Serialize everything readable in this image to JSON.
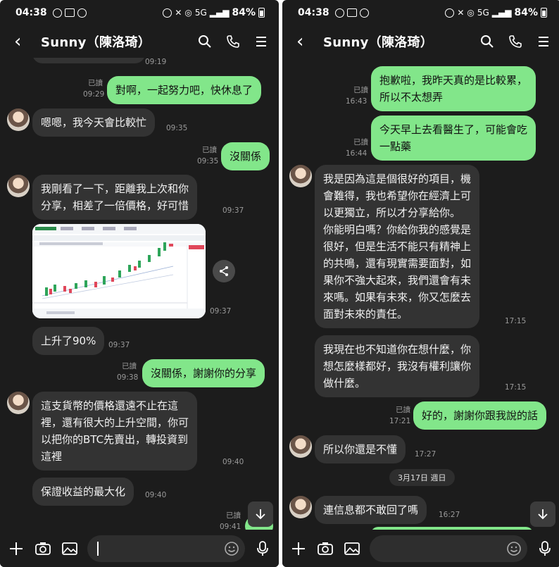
{
  "status": {
    "time": "04:38",
    "battery": "84%",
    "network": "5G"
  },
  "header": {
    "title": "Sunny（陳洛琦）"
  },
  "left": {
    "top_cutoff_time": "09:19",
    "messages": [
      {
        "dir": "out",
        "text": "對啊，一起努力吧，快休息了",
        "read": "已讀",
        "time": "09:29"
      },
      {
        "dir": "in",
        "text": "嗯嗯，我今天會比較忙",
        "time": "09:35"
      },
      {
        "dir": "out",
        "text": "沒關係",
        "read": "已讀",
        "time": "09:35"
      },
      {
        "dir": "in",
        "text": "我剛看了一下，距離我上次和你\n分享，相差了一倍價格，好可惜",
        "time": "09:37"
      },
      {
        "dir": "img",
        "time": "09:37"
      },
      {
        "dir": "in",
        "text": "上升了90%",
        "time": "09:37"
      },
      {
        "dir": "out",
        "text": "沒關係，謝謝你的分享",
        "read": "已讀",
        "time": "09:38"
      },
      {
        "dir": "in",
        "text": "這支貨幣的價格還遠不止在這\n裡，還有很大的上升空間，你可\n以把你的BTC先賣出，轉投資到\n這裡",
        "time": "09:40"
      },
      {
        "dir": "in",
        "text": "保證收益的最大化",
        "time": "09:40"
      },
      {
        "dir": "out",
        "text": "",
        "read": "已讀",
        "time": "09:41"
      }
    ]
  },
  "right": {
    "messages": [
      {
        "dir": "out",
        "text": "抱歉啦，我昨天真的是比較累，\n所以不太想弄",
        "read": "已讀",
        "time": "16:43"
      },
      {
        "dir": "out",
        "text": "今天早上去看醫生了，可能會吃\n一點藥",
        "read": "已讀",
        "time": "16:44"
      },
      {
        "dir": "in",
        "text": "我是因為這是個很好的項目，機\n會難得，我也希望你在經濟上可\n以更獨立，所以才分享給你。\n你能明白嗎？你給你我的感覺是\n很好，但是生活不能只有精神上\n的共鳴，還有現實需要面對，如\n果你不強大起來，我們還會有未\n來嗎。如果有未來，你又怎麼去\n面對未來的責任。",
        "time": "17:15"
      },
      {
        "dir": "in",
        "text": "我現在也不知道你在想什麼，你\n想怎麼樣都好，我沒有權利讓你\n做什麼。",
        "time": "17:15"
      },
      {
        "dir": "out",
        "text": "好的，謝謝你跟我說的話",
        "read": "已讀",
        "time": "17:21"
      },
      {
        "dir": "in",
        "text": "所以你還是不懂",
        "time": "17:27"
      },
      {
        "dir": "date",
        "text": "3月17日 週日"
      },
      {
        "dir": "in",
        "text": "連信息都不敢回了嗎",
        "time": "16:27"
      }
    ]
  },
  "icons": {
    "back": "chevron-left-icon",
    "search": "search-icon",
    "call": "phone-icon",
    "menu": "menu-icon",
    "share": "share-icon",
    "scroll_down": "arrow-down-icon",
    "add": "plus-icon",
    "camera": "camera-icon",
    "gallery": "image-icon",
    "emoji": "emoji-icon",
    "mic": "microphone-icon"
  },
  "colors": {
    "background": "#1c1c1c",
    "incoming_bubble": "#333333",
    "outgoing_bubble": "#82e68a"
  }
}
